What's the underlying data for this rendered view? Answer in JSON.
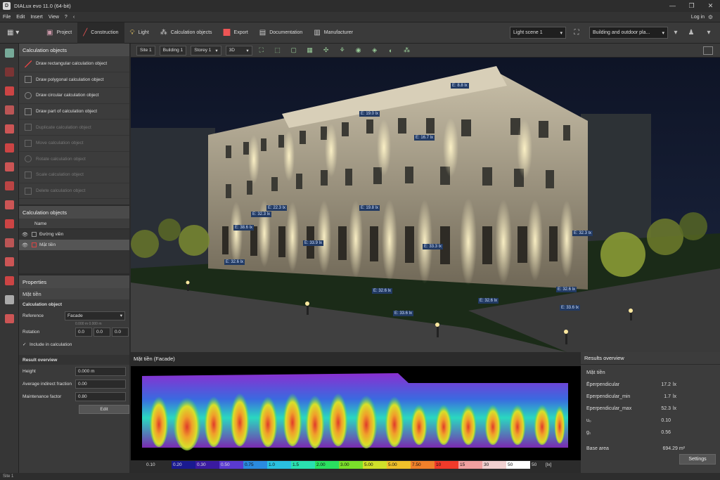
{
  "window": {
    "title": "DIALux evo 11.0 (64-bit)",
    "controls": [
      "—",
      "❐",
      "✕"
    ]
  },
  "menu": {
    "items": [
      "File",
      "Edit",
      "Insert",
      "View",
      "?"
    ],
    "login": "Log in"
  },
  "tabs": [
    {
      "label": "Project",
      "icon": "project-icon"
    },
    {
      "label": "Construction",
      "icon": "construction-icon",
      "active": true
    },
    {
      "label": "Light",
      "icon": "light-icon"
    },
    {
      "label": "Calculation objects",
      "icon": "calc-objects-icon"
    },
    {
      "label": "Export",
      "icon": "export-icon"
    },
    {
      "label": "Documentation",
      "icon": "documentation-icon"
    },
    {
      "label": "Manufacturer",
      "icon": "manufacturer-icon"
    }
  ],
  "light_scene": "Light scene 1",
  "building_select": "Building and outdoor pla...",
  "left_panel": {
    "title": "Calculation objects",
    "tools": [
      {
        "label": "Draw rectangular calculation object",
        "enabled": true
      },
      {
        "label": "Draw polygonal calculation object",
        "enabled": true
      },
      {
        "label": "Draw circular calculation object",
        "enabled": true
      },
      {
        "label": "Draw part of calculation object",
        "enabled": true
      },
      {
        "label": "Duplicate calculation object",
        "enabled": false
      },
      {
        "label": "Move calculation object",
        "enabled": false
      },
      {
        "label": "Rotate calculation object",
        "enabled": false
      },
      {
        "label": "Scale calculation object",
        "enabled": false
      },
      {
        "label": "Delete calculation object",
        "enabled": false
      }
    ]
  },
  "objects_panel": {
    "title": "Calculation objects",
    "column": "Name",
    "rows": [
      {
        "name": "Đường viền",
        "selected": false
      },
      {
        "name": "Mặt tiền",
        "selected": true
      }
    ]
  },
  "properties": {
    "title": "Properties",
    "object_name": "Mặt tiền",
    "section": "Calculation object",
    "reference_label": "Reference",
    "reference_value": "Facade",
    "offset_hint": "0.000 m   0.000 m",
    "rotation_label": "Rotation",
    "rotation": [
      "0.0",
      "0.0",
      "0.0"
    ],
    "include_label": "Include in calculation",
    "result_section": "Result overview",
    "height_label": "Height",
    "height_value": "0.000 m",
    "indirect_label": "Average indirect fraction",
    "indirect_value": "0.00",
    "maintenance_label": "Maintenance factor",
    "maintenance_value": "0.80",
    "edit_label": "Edit"
  },
  "viewport_toolbar": {
    "site": "Site 1",
    "building": "Building 1",
    "storey": "Storey 1",
    "view": "3D"
  },
  "lux_labels": [
    "E: 8.8 lx",
    "E: 19.0 lx",
    "E: 16.7 lx",
    "E: 22.3 lx",
    "E: 32.3 lx",
    "E: 19.8 lx",
    "E: 38.6 lx",
    "E: 33.9 lx",
    "E: 33.3 lx",
    "E: 32.6 lx",
    "E: 32.6 lx",
    "E: 32.3 lx",
    "E: 32.6 lx",
    "E: 32.6 lx",
    "E: 33.6 lx",
    "E: 33.6 lx"
  ],
  "facade_panel": {
    "title": "Mặt tiền (Facade)"
  },
  "legend": {
    "values": [
      "0.10",
      "0.20",
      "0.30",
      "0.50",
      "0.75",
      "1.0",
      "1.5",
      "2.00",
      "3.00",
      "5.00",
      "5.00",
      "7.50",
      "10",
      "15",
      "30",
      "50",
      "50",
      "[lx]"
    ],
    "colors": [
      "#1a1a2e",
      "#1a1a90",
      "#3a1aa0",
      "#5a3ad0",
      "#2a8ae0",
      "#2ac0e0",
      "#2ae0b0",
      "#2ae060",
      "#7ae02a",
      "#d0e02a",
      "#f0c02a",
      "#f0802a",
      "#f03a2a",
      "#f0a0a0",
      "#f0d0d0",
      "#ffffff",
      "#111111",
      "#111111"
    ]
  },
  "results": {
    "title": "Results overview",
    "name": "Mặt tiền",
    "rows": [
      {
        "k": "Ēperpendicular",
        "v": "17.2",
        "u": "lx"
      },
      {
        "k": "Eperpendicular_min",
        "v": "1.7",
        "u": "lx"
      },
      {
        "k": "Eperpendicular_max",
        "v": "52.3",
        "u": "lx"
      },
      {
        "k": "u₀",
        "v": "0.10",
        "u": ""
      },
      {
        "k": "g₁",
        "v": "0.56",
        "u": ""
      }
    ],
    "base_area_label": "Base area",
    "base_area_value": "694.29 m²",
    "settings_label": "Settings"
  },
  "status": "Site 1"
}
